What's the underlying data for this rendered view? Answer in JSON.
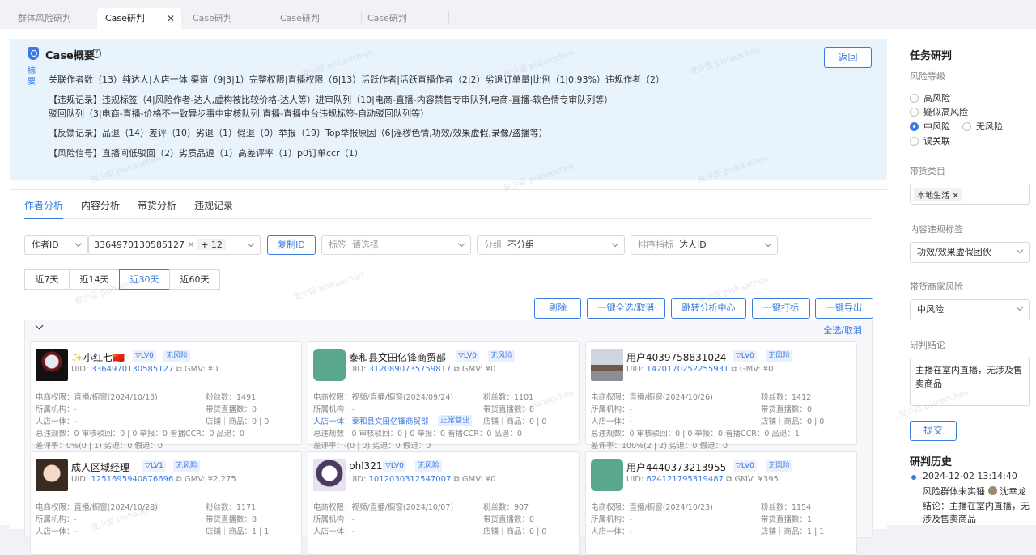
{
  "tabs": [
    {
      "label": "群体风险研判"
    },
    {
      "label": "Case研判"
    },
    {
      "label": "Case研判"
    },
    {
      "label": "Case研判"
    },
    {
      "label": "Case研判"
    }
  ],
  "overview": {
    "title": "Case概要",
    "side_label": "摘要",
    "back_label": "返回",
    "lines": [
      "关联作者数（13）纯达人|人店一体|渠道（9|3|1）完整权限|直播权限（6|13）活跃作者|活跃直播作者（2|2）劣退订单量|比例（1|0.93%）违规作者（2）",
      "【违规记录】违规标签（4|风险作者-达人,虚构被比较价格-达人等）进审队列（10|电商-直播-内容禁售专审队列,电商-直播-软色情专审队列等）",
      "驳回队列（3|电商-直播-价格不一致异步事中审核队列,直播-直播中台违规标签-自动驳回队列等）",
      "【反馈记录】品退（14）差评（10）劣退（1）假退（0）举报（19）Top举报原因（6|淫秽色情,功效/效果虚假,录像/盗播等）",
      "【风险信号】直播间低驳回（2）劣质品退（1）高差评率（1）p0订单ccr（1）"
    ]
  },
  "subtabs": [
    "作者分析",
    "内容分析",
    "带货分析",
    "违规记录"
  ],
  "filters": {
    "author_id_label": "作者ID",
    "author_id_value": "3364970130585127",
    "author_id_more": "+ 12",
    "copy_label": "复制ID",
    "tag_label": "标签",
    "tag_placeholder": "请选择",
    "group_label": "分组",
    "group_value": "不分组",
    "sort_label": "排序指标",
    "sort_value": "达人ID"
  },
  "periods": [
    "近7天",
    "近14天",
    "近30天",
    "近60天"
  ],
  "actions": [
    "剔除",
    "一键全选/取消",
    "跳转分析中心",
    "一键打标",
    "一键导出"
  ],
  "select_all": "全选/取消",
  "watermark": "皮少臣 pishaochen",
  "cards": [
    {
      "name": "✨小红七🇨🇳",
      "lv": "LV0",
      "risk": "无风险",
      "uid": "3364970130585127",
      "gmv": "¥0",
      "r1a": "电商权限：直播/橱窗(2024/10/13)",
      "r1b": "粉丝数：1491",
      "r2a": "所属机构：-",
      "r2b": "带货直播数：0",
      "r3a": "人店一体：-",
      "r3b": "店铺｜商品：0 | 0",
      "r4": "总违规数：0  审核驳回：0 | 0  举报：0  看播CCR：0  品退：0",
      "r5": "差评率：0%(0 | 1)  劣退：0  假退：0"
    },
    {
      "name": "泰和县文田亿锋商贸部",
      "lv": "LV0",
      "risk": "无风险",
      "uid": "3120890735759817",
      "gmv": "¥0",
      "r1a": "电商权限：视频/直播/橱窗(2024/09/24)",
      "r1b": "粉丝数：1101",
      "r2a": "所属机构：-",
      "r2b": "带货直播数：0",
      "r3a": "人店一体：泰和县文田亿锋商贸部",
      "r3b": "店铺｜商品：0 | 0",
      "r3tag": "正常营业",
      "r4": "总违规数：0  审核驳回：0 | 0  举报：0  看播CCR：0  品退：0",
      "r5": "差评率：-(0 | 0)  劣退：0  假退：0"
    },
    {
      "name": "用户4039758831024",
      "lv": "LV0",
      "risk": "无风险",
      "uid": "1420170252255931",
      "gmv": "¥0",
      "r1a": "电商权限：直播/橱窗(2024/10/26)",
      "r1b": "粉丝数：1412",
      "r2a": "所属机构：-",
      "r2b": "带货直播数：0",
      "r3a": "人店一体：-",
      "r3b": "店铺｜商品：0 | 0",
      "r4": "总违规数：0  审核驳回：0 | 0  举报：0  看播CCR：0  品退：1",
      "r5": "差评率：100%(2 | 2)  劣退：0  假退：0"
    },
    {
      "name": "成人区域经理",
      "lv": "LV1",
      "risk": "无风险",
      "uid": "1251695940876696",
      "gmv": "¥2,275",
      "r1a": "电商权限：直播/橱窗(2024/10/28)",
      "r1b": "粉丝数：1171",
      "r2a": "所属机构：-",
      "r2b": "带货直播数：8",
      "r3a": "人店一体：-",
      "r3b": "店铺｜商品：1 | 1"
    },
    {
      "name": "phl321",
      "lv": "LV0",
      "risk": "无风险",
      "uid": "1012030312547007",
      "gmv": "¥0",
      "r1a": "电商权限：视频/直播/橱窗(2024/10/07)",
      "r1b": "粉丝数：907",
      "r2a": "所属机构：-",
      "r2b": "带货直播数：0",
      "r3a": "人店一体：-",
      "r3b": "店铺｜商品：0 | 0"
    },
    {
      "name": "用户4440373213955",
      "lv": "LV0",
      "risk": "无风险",
      "uid": "624121795319487",
      "gmv": "¥395",
      "r1a": "电商权限：直播/橱窗(2024/10/23)",
      "r1b": "粉丝数：1154",
      "r2a": "所属机构：-",
      "r2b": "带货直播数：1",
      "r3a": "人店一体：-",
      "r3b": "店铺｜商品：1 | 1"
    }
  ],
  "side": {
    "title": "任务研判",
    "risk_level_label": "风险等级",
    "risk_options": [
      "高风险",
      "疑似高风险",
      "中风险",
      "无风险",
      "误关联"
    ],
    "category_label": "带货类目",
    "category_tag": "本地生活",
    "violation_label": "内容违规标签",
    "violation_value": "功效/效果虚假团伙",
    "merchant_label": "带货商家风险",
    "merchant_value": "中风险",
    "conclusion_label": "研判结论",
    "conclusion_text": "主播在室内直播，无涉及售卖商品",
    "submit_label": "提交",
    "history_title": "研判历史",
    "history_time": "2024-12-02 13:14:40",
    "history_group": "风险群体未实锤",
    "history_user": "沈幸龙",
    "history_conclusion_1": "结论：主播在室内直播，无",
    "history_conclusion_2": "涉及售卖商品"
  }
}
